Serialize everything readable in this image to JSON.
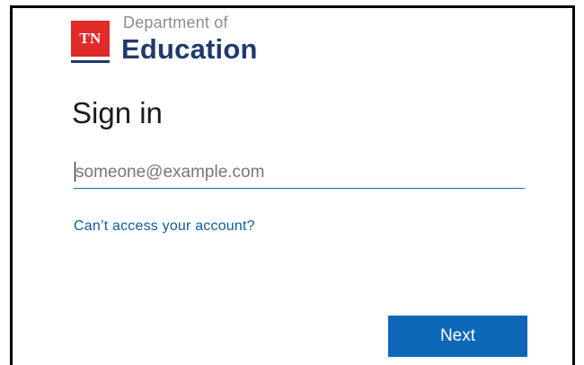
{
  "logo": {
    "badge_text": "TN",
    "line1": "Department of",
    "line2": "Education",
    "badge_color": "#e12a2a",
    "brand_color": "#1f3a6e"
  },
  "title": "Sign in",
  "email": {
    "value": "",
    "placeholder": "someone@example.com"
  },
  "cant_access_link": "Can’t access your account?",
  "next_button": "Next",
  "colors": {
    "accent": "#0d67b9",
    "link": "#0a5f99"
  }
}
